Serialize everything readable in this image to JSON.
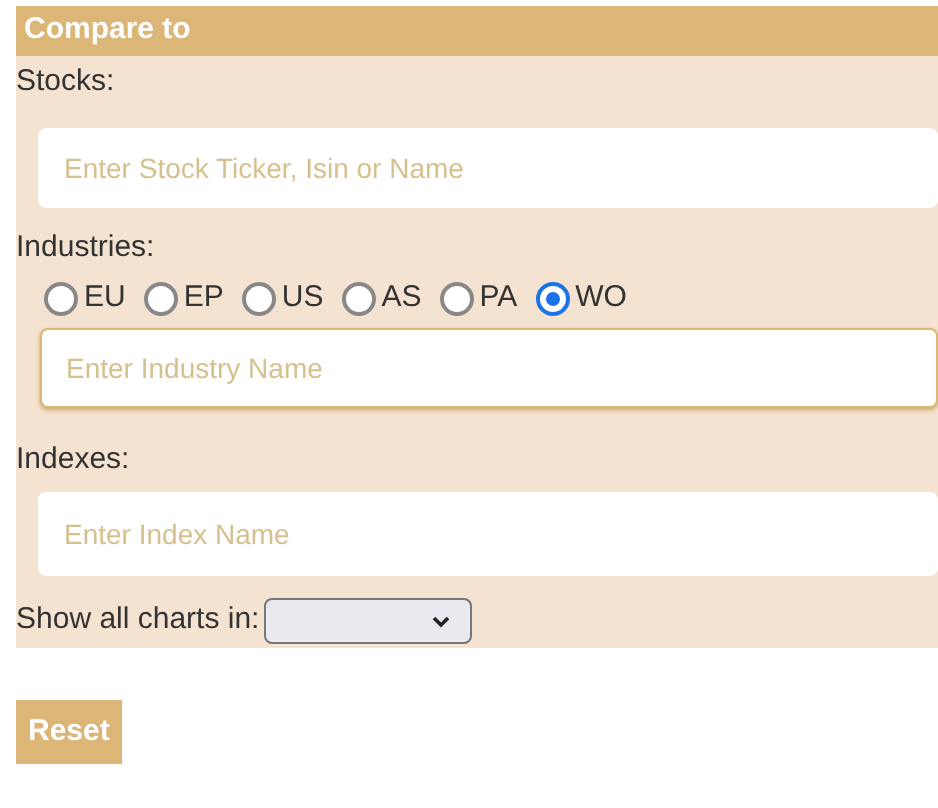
{
  "panel": {
    "title": "Compare to"
  },
  "stocks": {
    "label": "Stocks:",
    "placeholder": "Enter Stock Ticker, Isin or Name",
    "focused": false
  },
  "industries": {
    "label": "Industries:",
    "regions": [
      {
        "label": "EU",
        "selected": false
      },
      {
        "label": "EP",
        "selected": false
      },
      {
        "label": "US",
        "selected": false
      },
      {
        "label": "AS",
        "selected": false
      },
      {
        "label": "PA",
        "selected": false
      },
      {
        "label": "WO",
        "selected": true
      }
    ],
    "placeholder": "Enter Industry Name",
    "focused": true
  },
  "indexes": {
    "label": "Indexes:",
    "placeholder": "Enter Index Name",
    "focused": false
  },
  "charts": {
    "label": "Show all charts in:"
  },
  "buttons": [
    "Reset"
  ]
}
